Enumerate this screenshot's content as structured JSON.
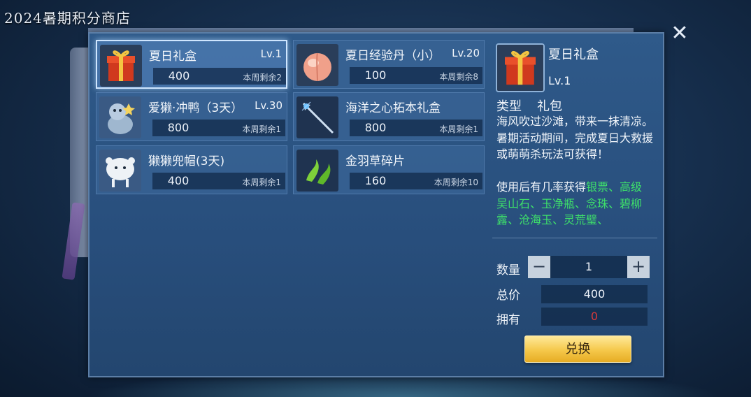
{
  "window": {
    "title": "2024暑期积分商店"
  },
  "items": [
    {
      "name": "夏日礼盒",
      "level": "Lv.1",
      "price": "400",
      "remaining": "本周剩余2",
      "icon": "gift-box-icon"
    },
    {
      "name": "夏日经验丹（小）",
      "level": "Lv.20",
      "price": "100",
      "remaining": "本周剩余8",
      "icon": "peach-icon"
    },
    {
      "name": "爱獭·冲鸭（3天）",
      "level": "Lv.30",
      "price": "800",
      "remaining": "本周剩余1",
      "icon": "otter-mount-icon"
    },
    {
      "name": "海洋之心拓本礼盒",
      "level": "",
      "price": "800",
      "remaining": "本周剩余1",
      "icon": "ocean-staff-icon"
    },
    {
      "name": "獭獭兜帽(3天)",
      "level": "",
      "price": "400",
      "remaining": "本周剩余1",
      "icon": "otter-hood-icon"
    },
    {
      "name": "金羽草碎片",
      "level": "",
      "price": "160",
      "remaining": "本周剩余10",
      "icon": "golden-feather-grass-icon"
    }
  ],
  "detail": {
    "name": "夏日礼盒",
    "level": "Lv.1",
    "type_label": "类型",
    "type_value": "礼包",
    "description": "海风吹过沙滩，带来一抹清凉。暑期活动期间，完成夏日大救援或萌萌杀玩法可获得！",
    "obtain_prefix": "使用后有几率获得",
    "obtain_items": "银票、高级吴山石、玉净瓶、念珠、碧柳露、沧海玉、灵荒璧、",
    "quantity_label": "数量",
    "quantity": "1",
    "total_label": "总价",
    "total": "400",
    "owned_label": "拥有",
    "owned": "0",
    "minus": "−",
    "plus": "+",
    "exchange_label": "兑换"
  },
  "colors": {
    "accent_green": "#3ee06a",
    "owned_red": "#d93a3a",
    "button_gold": "#f5c84a"
  }
}
